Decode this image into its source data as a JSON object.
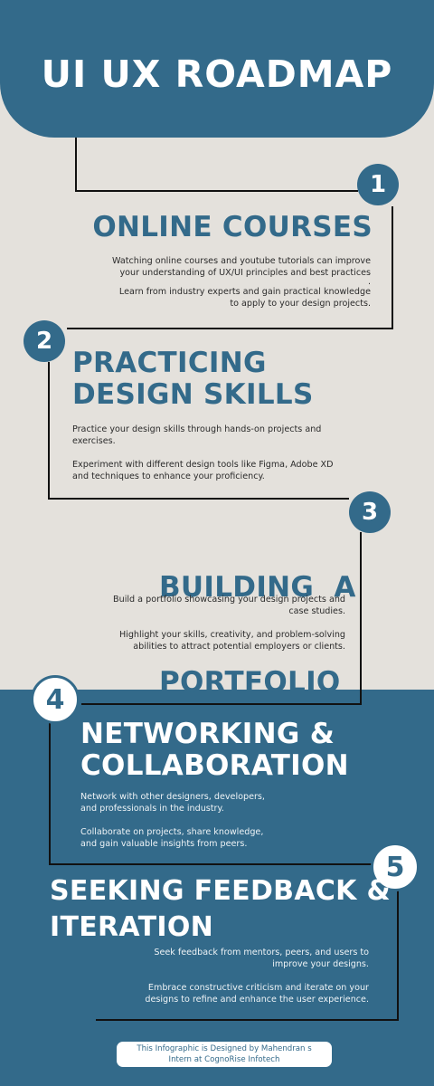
{
  "header": {
    "title": "UI UX ROADMAP"
  },
  "steps": [
    {
      "number": "1",
      "title_lines": [
        "ONLINE COURSES"
      ],
      "paragraphs": [
        [
          "Watching online courses and youtube tutorials can improve",
          "your understanding of UX/UI principles and best practices",
          "."
        ],
        [
          "Learn from industry experts and gain practical knowledge",
          "to apply to your design projects."
        ]
      ]
    },
    {
      "number": "2",
      "title_lines": [
        "PRACTICING",
        "DESIGN SKILLS"
      ],
      "paragraphs": [
        [
          "Practice your design skills through hands-on projects and",
          "exercises."
        ],
        [
          "Experiment with different design tools like Figma, Adobe XD",
          "and techniques to enhance your proficiency."
        ]
      ]
    },
    {
      "number": "3",
      "title_lines": [
        "BUILDING  A",
        "PORTFOLIO"
      ],
      "paragraphs": [
        [
          "Build a portfolio showcasing your design projects and",
          "case studies."
        ],
        [
          "Highlight your skills, creativity, and problem-solving",
          "abilities to attract potential employers or clients."
        ]
      ]
    },
    {
      "number": "4",
      "title_lines": [
        "NETWORKING &",
        "COLLABORATION"
      ],
      "paragraphs": [
        [
          "Network with other designers, developers,",
          "and professionals in the industry."
        ],
        [
          "Collaborate on projects, share knowledge,",
          "and gain valuable insights from peers."
        ]
      ]
    },
    {
      "number": "5",
      "title_lines": [
        "SEEKING FEEDBACK &",
        "ITERATION"
      ],
      "paragraphs": [
        [
          "Seek feedback from mentors, peers, and users to",
          "improve your designs."
        ],
        [
          "Embrace constructive criticism and iterate on your",
          "designs to refine and enhance the user experience."
        ]
      ]
    }
  ],
  "footer": {
    "credit_lines": [
      "This Infographic is Designed by Mahendran s",
      "Intern at CognoRise Infotech"
    ]
  },
  "colors": {
    "primary": "#336a8a",
    "background": "#e4e1dc",
    "line": "#111111",
    "white": "#ffffff"
  }
}
